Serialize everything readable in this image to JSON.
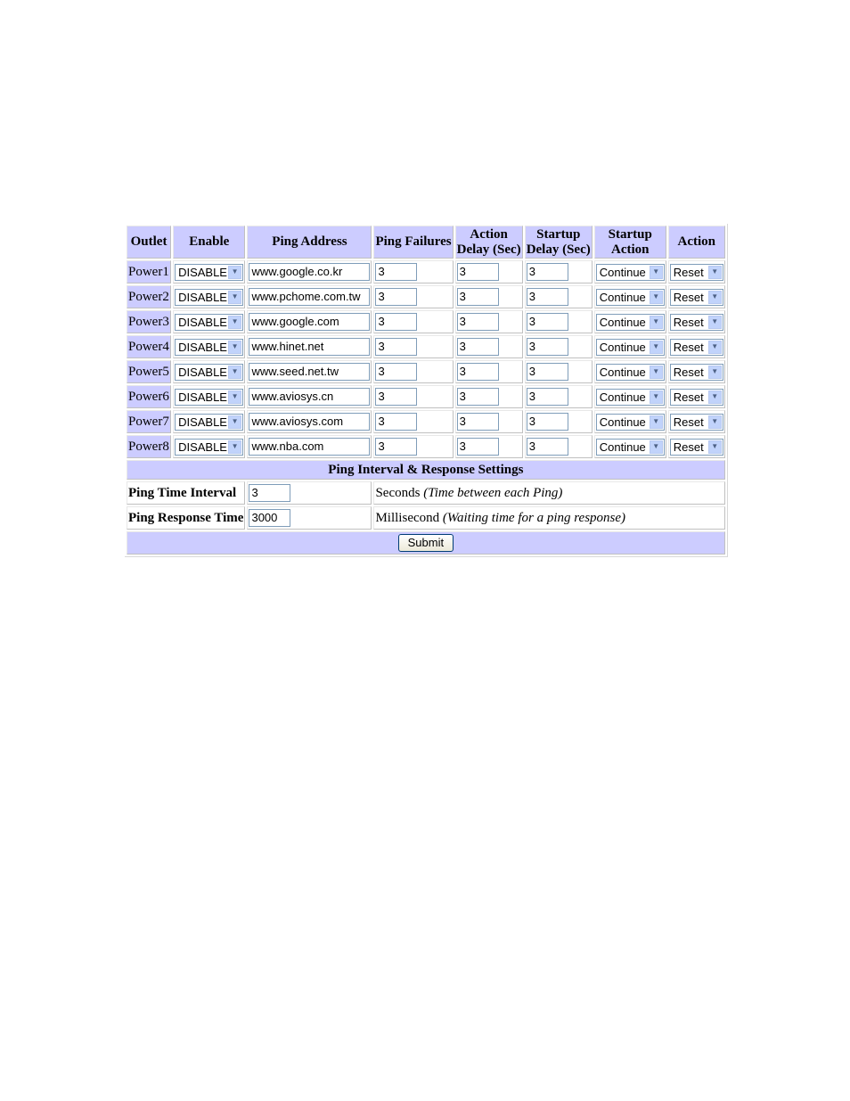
{
  "headers": {
    "outlet": "Outlet",
    "enable": "Enable",
    "ping_address": "Ping Address",
    "ping_failures": "Ping Failures",
    "action_delay_1": "Action",
    "action_delay_2": "Delay (Sec)",
    "startup_delay_1": "Startup",
    "startup_delay_2": "Delay (Sec)",
    "startup_action_1": "Startup",
    "startup_action_2": "Action",
    "action": "Action"
  },
  "rows": [
    {
      "outlet": "Power1",
      "enable": "DISABLE",
      "ping_address": "www.google.co.kr",
      "ping_failures": "3",
      "action_delay": "3",
      "startup_delay": "3",
      "startup_action": "Continue",
      "action": "Reset"
    },
    {
      "outlet": "Power2",
      "enable": "DISABLE",
      "ping_address": "www.pchome.com.tw",
      "ping_failures": "3",
      "action_delay": "3",
      "startup_delay": "3",
      "startup_action": "Continue",
      "action": "Reset"
    },
    {
      "outlet": "Power3",
      "enable": "DISABLE",
      "ping_address": "www.google.com",
      "ping_failures": "3",
      "action_delay": "3",
      "startup_delay": "3",
      "startup_action": "Continue",
      "action": "Reset"
    },
    {
      "outlet": "Power4",
      "enable": "DISABLE",
      "ping_address": "www.hinet.net",
      "ping_failures": "3",
      "action_delay": "3",
      "startup_delay": "3",
      "startup_action": "Continue",
      "action": "Reset"
    },
    {
      "outlet": "Power5",
      "enable": "DISABLE",
      "ping_address": "www.seed.net.tw",
      "ping_failures": "3",
      "action_delay": "3",
      "startup_delay": "3",
      "startup_action": "Continue",
      "action": "Reset"
    },
    {
      "outlet": "Power6",
      "enable": "DISABLE",
      "ping_address": "www.aviosys.cn",
      "ping_failures": "3",
      "action_delay": "3",
      "startup_delay": "3",
      "startup_action": "Continue",
      "action": "Reset"
    },
    {
      "outlet": "Power7",
      "enable": "DISABLE",
      "ping_address": "www.aviosys.com",
      "ping_failures": "3",
      "action_delay": "3",
      "startup_delay": "3",
      "startup_action": "Continue",
      "action": "Reset"
    },
    {
      "outlet": "Power8",
      "enable": "DISABLE",
      "ping_address": "www.nba.com",
      "ping_failures": "3",
      "action_delay": "3",
      "startup_delay": "3",
      "startup_action": "Continue",
      "action": "Reset"
    }
  ],
  "icons": {
    "dropdown": "chevron-down-icon"
  },
  "settings": {
    "section_title": "Ping Interval & Response Settings",
    "interval": {
      "label": "Ping Time Interval",
      "value": "3",
      "unit": "Seconds",
      "note": "(Time between each Ping)"
    },
    "response": {
      "label": "Ping Response Time",
      "value": "3000",
      "unit": "Millisecond",
      "note": "(Waiting time for a ping response)"
    }
  },
  "submit_label": "Submit",
  "colors": {
    "header_bg": "#ccccff",
    "input_border": "#7f9db9",
    "dropdown_arrow_bg": "#c1d3fb"
  }
}
